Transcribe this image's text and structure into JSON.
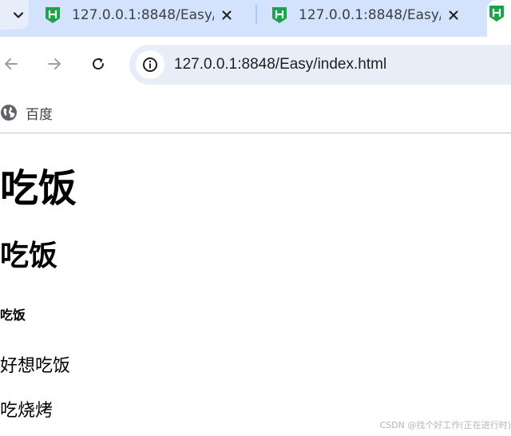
{
  "tabs": [
    {
      "title": "127.0.0.1:8848/Easy/",
      "favicon": "hbuilder-icon"
    },
    {
      "title": "127.0.0.1:8848/Easy/",
      "favicon": "hbuilder-icon"
    }
  ],
  "toolbar": {
    "url": "127.0.0.1:8848/Easy/index.html"
  },
  "bookmarks": [
    {
      "label": "百度",
      "icon": "globe-icon"
    }
  ],
  "page": {
    "h1": "吃饭",
    "h2": "吃饭",
    "h5": "吃饭",
    "p1": "好想吃饭",
    "p2": "吃烧烤"
  },
  "watermark": "CSDN @找个好工作(正在进行时)",
  "colors": {
    "tabstrip": "#d3e3fd",
    "favicon_green": "#1aa34a",
    "omnibox": "#e8eef8"
  }
}
